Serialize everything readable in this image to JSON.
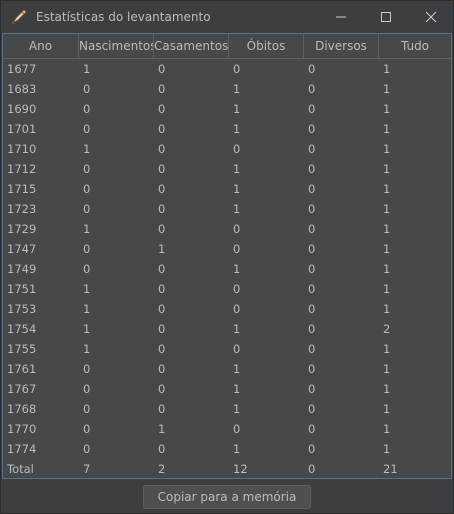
{
  "window": {
    "title": "Estatísticas do levantamento",
    "icon": "quill-pen-icon"
  },
  "table": {
    "columns": [
      "Ano",
      "Nascimentos",
      "Casamentos",
      "Óbitos",
      "Diversos",
      "Tudo"
    ],
    "rows": [
      [
        "1677",
        "1",
        "0",
        "0",
        "0",
        "1"
      ],
      [
        "1683",
        "0",
        "0",
        "1",
        "0",
        "1"
      ],
      [
        "1690",
        "0",
        "0",
        "1",
        "0",
        "1"
      ],
      [
        "1701",
        "0",
        "0",
        "1",
        "0",
        "1"
      ],
      [
        "1710",
        "1",
        "0",
        "0",
        "0",
        "1"
      ],
      [
        "1712",
        "0",
        "0",
        "1",
        "0",
        "1"
      ],
      [
        "1715",
        "0",
        "0",
        "1",
        "0",
        "1"
      ],
      [
        "1723",
        "0",
        "0",
        "1",
        "0",
        "1"
      ],
      [
        "1729",
        "1",
        "0",
        "0",
        "0",
        "1"
      ],
      [
        "1747",
        "0",
        "1",
        "0",
        "0",
        "1"
      ],
      [
        "1749",
        "0",
        "0",
        "1",
        "0",
        "1"
      ],
      [
        "1751",
        "1",
        "0",
        "0",
        "0",
        "1"
      ],
      [
        "1753",
        "1",
        "0",
        "0",
        "0",
        "1"
      ],
      [
        "1754",
        "1",
        "0",
        "1",
        "0",
        "2"
      ],
      [
        "1755",
        "1",
        "0",
        "0",
        "0",
        "1"
      ],
      [
        "1761",
        "0",
        "0",
        "1",
        "0",
        "1"
      ],
      [
        "1767",
        "0",
        "0",
        "1",
        "0",
        "1"
      ],
      [
        "1768",
        "0",
        "0",
        "1",
        "0",
        "1"
      ],
      [
        "1770",
        "0",
        "1",
        "0",
        "0",
        "1"
      ],
      [
        "1774",
        "0",
        "0",
        "1",
        "0",
        "1"
      ],
      [
        "Total",
        "7",
        "2",
        "12",
        "0",
        "21"
      ]
    ]
  },
  "footer": {
    "copy_label": "Copiar para a memória"
  }
}
